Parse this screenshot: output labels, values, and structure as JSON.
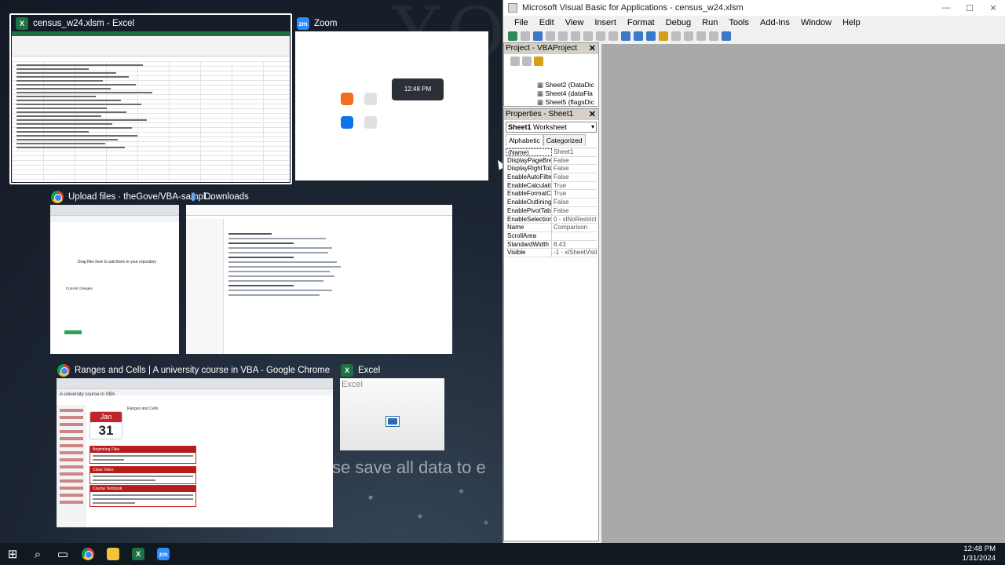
{
  "desktop": {
    "bg_text": "YOU",
    "overlay_text": "se save all data to e"
  },
  "windows": [
    {
      "key": "excel_main",
      "title": "census_w24.xlsm - Excel",
      "icon": "excel-icon"
    },
    {
      "key": "zoom",
      "title": "Zoom",
      "icon": "zoom-icon",
      "time_card": "12:48 PM"
    },
    {
      "key": "github",
      "title": "Upload files · theGove/VBA-sampl...",
      "icon": "chrome-icon",
      "drop_text": "Drag files here to add them to your repository",
      "commit_label": "Commit changes"
    },
    {
      "key": "downloads",
      "title": "Downloads",
      "icon": "downloads-folder-icon",
      "group_today": "Today (1)",
      "group_week": "Earlier this week (3)",
      "group_last": "Last week (5)",
      "group_month": "Earlier this month (2)"
    },
    {
      "key": "course",
      "title": "Ranges and Cells | A university course in VBA - Google Chrome",
      "icon": "chrome-icon",
      "site_title": "A university course in VBA",
      "page_heading": "Ranges and Cells",
      "cal_month": "Jan",
      "cal_day": "31",
      "box1": "Beginning Files",
      "box2": "Class Video",
      "box3": "Course Textbook"
    },
    {
      "key": "excel_blank",
      "title": "Excel",
      "icon": "excel-icon",
      "splash": "Excel"
    }
  ],
  "vbe": {
    "title": "Microsoft Visual Basic for Applications - census_w24.xlsm",
    "menu": [
      "File",
      "Edit",
      "View",
      "Insert",
      "Format",
      "Debug",
      "Run",
      "Tools",
      "Add-Ins",
      "Window",
      "Help"
    ],
    "project": {
      "title": "Project - VBAProject",
      "items": [
        "Sheet2 (DataDic",
        "Sheet4 (dataFla",
        "Sheet5 (flagsDic"
      ]
    },
    "properties": {
      "title": "Properties - Sheet1",
      "object": "Sheet1",
      "object_type": "Worksheet",
      "tab_alpha": "Alphabetic",
      "tab_cat": "Categorized",
      "rows": [
        {
          "k": "(Name)",
          "v": "Sheet1"
        },
        {
          "k": "DisplayPageBreak",
          "v": "False"
        },
        {
          "k": "DisplayRightToLef",
          "v": "False"
        },
        {
          "k": "EnableAutoFilter",
          "v": "False"
        },
        {
          "k": "EnableCalculation",
          "v": "True"
        },
        {
          "k": "EnableFormatCon",
          "v": "True"
        },
        {
          "k": "EnableOutlining",
          "v": "False"
        },
        {
          "k": "EnablePivotTable",
          "v": "False"
        },
        {
          "k": "EnableSelection",
          "v": "0 - xlNoRestricti"
        },
        {
          "k": "Name",
          "v": "Comparison"
        },
        {
          "k": "ScrollArea",
          "v": ""
        },
        {
          "k": "StandardWidth",
          "v": "8.43"
        },
        {
          "k": "Visible",
          "v": "-1 - xlSheetVisib"
        }
      ]
    }
  },
  "taskbar": {
    "time": "12:48 PM",
    "date": "1/31/2024",
    "apps": [
      "start-icon",
      "search-icon",
      "task-view-icon",
      "chrome-icon",
      "file-explorer-icon",
      "excel-icon",
      "zoom-icon"
    ]
  }
}
